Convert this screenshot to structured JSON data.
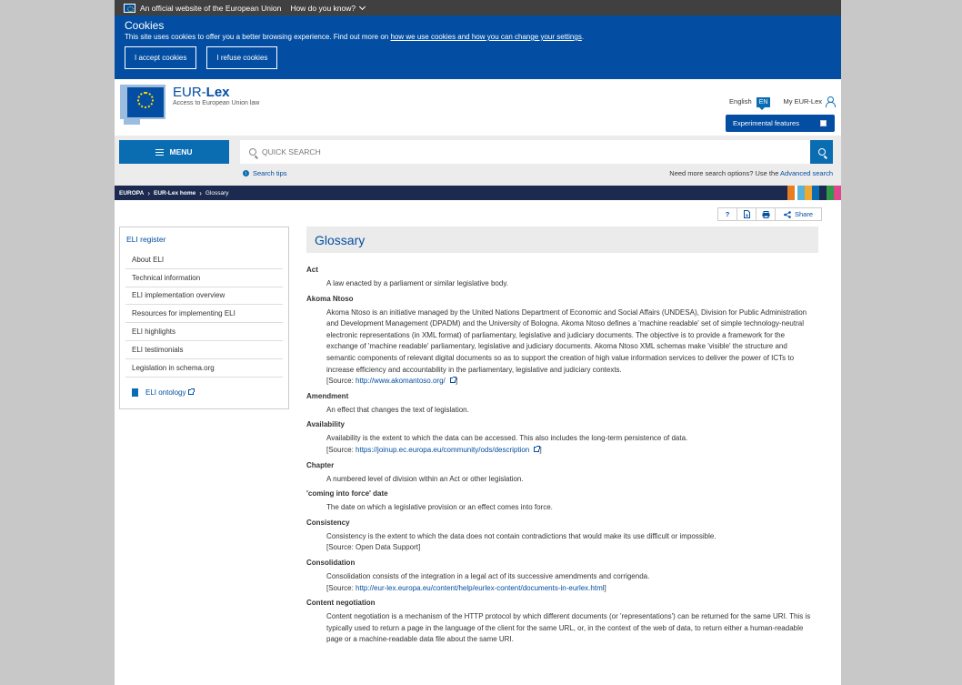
{
  "official_bar": {
    "text": "An official website of the European Union",
    "how_label": "How do you know?"
  },
  "cookies": {
    "title": "Cookies",
    "text": "This site uses cookies to offer you a better browsing experience. Find out more on",
    "link": "how we use cookies and how you can change your settings",
    "end": ".",
    "accept_label": "I accept cookies",
    "refuse_label": "I refuse cookies"
  },
  "header": {
    "logo_eur": "EUR-",
    "logo_lex": "Lex",
    "logo_sub": "Access to European Union law",
    "language": "English",
    "lang_code": "EN",
    "my_eurlex": "My EUR-Lex",
    "experimental": "Experimental features"
  },
  "search": {
    "menu_label": "MENU",
    "placeholder": "QUICK SEARCH",
    "tips": "Search tips",
    "more_options": "Need more search options? Use the",
    "advanced": "Advanced search"
  },
  "breadcrumb": [
    "EUROPA",
    "EUR-Lex home",
    "Glossary"
  ],
  "colors": {
    "brand_blue": "#034ea2",
    "accent_blue": "#0a6db2",
    "breadcrumb_bg": "#1b2a4e",
    "colorbar": [
      "#e87e21",
      "#ffffff",
      "#56b2d8",
      "#f0a830",
      "#0a6db2",
      "#1b2a4e",
      "#2e9a4a",
      "#e0468e"
    ]
  },
  "sidebar": {
    "title": "ELI register",
    "items": [
      "About ELI",
      "Technical information",
      "ELI implementation overview",
      "Resources for implementing ELI",
      "ELI highlights",
      "ELI testimonials",
      "Legislation in schema.org"
    ],
    "ontology": "ELI ontology"
  },
  "tools": {
    "help": "?",
    "share": "Share"
  },
  "page_title": "Glossary",
  "glossary": [
    {
      "term": "Act",
      "definition": "A law enacted by a parliament or similar legislative body."
    },
    {
      "term": "Akoma Ntoso",
      "definition": "Akoma Ntoso is an initiative managed by the United Nations Department of Economic and Social Affairs (UNDESA), Division for Public Administration and Development Management (DPADM) and the University of Bologna. Akoma Ntoso defines a 'machine readable' set of simple technology-neutral electronic representations (in XML format) of parliamentary, legislative and judiciary documents. The objective is to provide a framework for the exchange of 'machine readable' parliamentary, legislative and judiciary documents. Akoma Ntoso XML schemas make 'visible' the structure and semantic components of relevant digital documents so as to support the creation of high value information services to deliver the power of ICTs to increase efficiency and accountability in the parliamentary, legislative and judiciary contexts.",
      "source_prefix": "[Source:",
      "source_link": "http://www.akomantoso.org/",
      "source_suffix": "]"
    },
    {
      "term": "Amendment",
      "definition": "An effect that changes the text of legislation."
    },
    {
      "term": "Availability",
      "definition": "Availability is the extent to which the data can be accessed. This also includes the long-term persistence of data.",
      "source_prefix": "[Source:",
      "source_link": "https://joinup.ec.europa.eu/community/ods/description",
      "source_suffix": "]"
    },
    {
      "term": "Chapter",
      "definition": "A numbered level of division within an Act or other legislation."
    },
    {
      "term": "'coming into force' date",
      "definition": "The date on which a legislative provision or an effect comes into force."
    },
    {
      "term": "Consistency",
      "definition": "Consistency is the extent to which the data does not contain contradictions that would make its use difficult or impossible.",
      "source_text": "[Source: Open Data Support]"
    },
    {
      "term": "Consolidation",
      "definition": "Consolidation consists of the integration in a legal act of its successive amendments and corrigenda.",
      "source_prefix": "[Source:",
      "source_link": "http://eur-lex.europa.eu/content/help/eurlex-content/documents-in-eurlex.html",
      "source_suffix": "]"
    },
    {
      "term": "Content negotiation",
      "definition": "Content negotiation is a mechanism of the HTTP protocol by which different documents (or 'representations') can be returned for the same URI. This is typically used to return a page in the language of the client for the same URL, or, in the context of the web of data, to return either a human-readable page or a machine-readable data file about the same URI."
    }
  ]
}
